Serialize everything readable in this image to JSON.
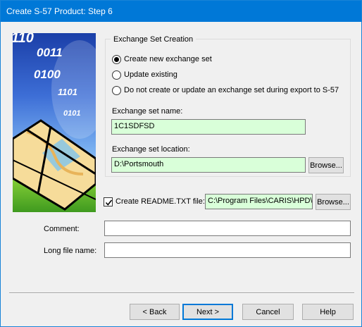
{
  "window": {
    "title": "Create S-57 Product: Step 6"
  },
  "side_image": {
    "bits": [
      "110",
      "0011",
      "0100",
      "1101",
      "0101"
    ]
  },
  "exchange_group": {
    "legend": "Exchange Set Creation",
    "options": [
      {
        "label": "Create new exchange set",
        "checked": true
      },
      {
        "label": "Update existing",
        "checked": false
      },
      {
        "label": "Do not create or update an exchange set during export to S-57",
        "checked": false
      }
    ],
    "name_label": "Exchange set name:",
    "name_value": "1C1SDFSD",
    "location_label": "Exchange set location:",
    "location_value": "D:\\Portsmouth",
    "browse_label": "Browse..."
  },
  "readme": {
    "label": "Create README.TXT file:",
    "checked": true,
    "path_value": "C:\\Program Files\\CARIS\\HPD\\",
    "browse_label": "Browse..."
  },
  "comment": {
    "label": "Comment:",
    "value": ""
  },
  "long_file_name": {
    "label": "Long file name:",
    "value": ""
  },
  "buttons": {
    "back": "< Back",
    "next": "Next >",
    "cancel": "Cancel",
    "help": "Help"
  }
}
